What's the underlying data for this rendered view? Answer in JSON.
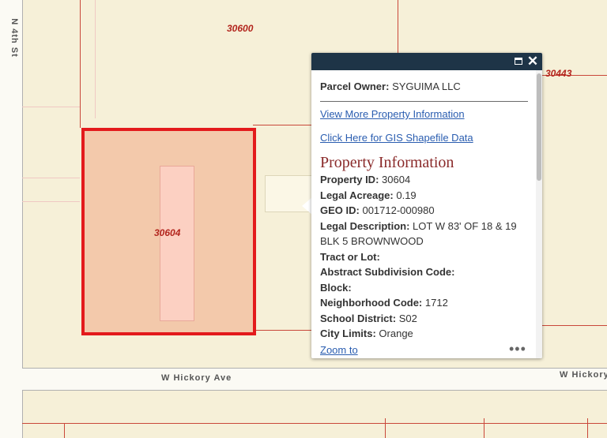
{
  "map": {
    "streets": {
      "north_4th": "N 4th St",
      "hickory_left": "W Hickory Ave",
      "hickory_right": "W Hickory"
    },
    "parcels": {
      "top": "30600",
      "right": "30443",
      "selected": "30604"
    },
    "selected_outline_color": "#e31a1c"
  },
  "popup": {
    "owner_label": "Parcel Owner:",
    "owner_value": "SYGUIMA LLC",
    "link_more": "View More Property Information",
    "link_shapefile": "Click Here for GIS Shapefile Data",
    "section_title": "Property Information",
    "fields": [
      {
        "label": "Property ID:",
        "value": "30604"
      },
      {
        "label": "Legal Acreage:",
        "value": "0.19"
      },
      {
        "label": "GEO ID:",
        "value": "001712-000980"
      },
      {
        "label": "Legal Description:",
        "value": "LOT W 83' OF 18 & 19 BLK 5 BROWNWOOD"
      },
      {
        "label": "Tract or Lot:",
        "value": ""
      },
      {
        "label": "Abstract Subdivision Code:",
        "value": ""
      },
      {
        "label": "Block:",
        "value": ""
      },
      {
        "label": "Neighborhood Code:",
        "value": "1712"
      },
      {
        "label": "School District:",
        "value": "S02"
      },
      {
        "label": "City Limits:",
        "value": "Orange"
      }
    ],
    "zoom_to": "Zoom to",
    "more_icon": "•••",
    "close_icon": "✕",
    "header_color": "#1e3447",
    "link_color": "#2a5db0",
    "title_color": "#8a2a2a"
  }
}
